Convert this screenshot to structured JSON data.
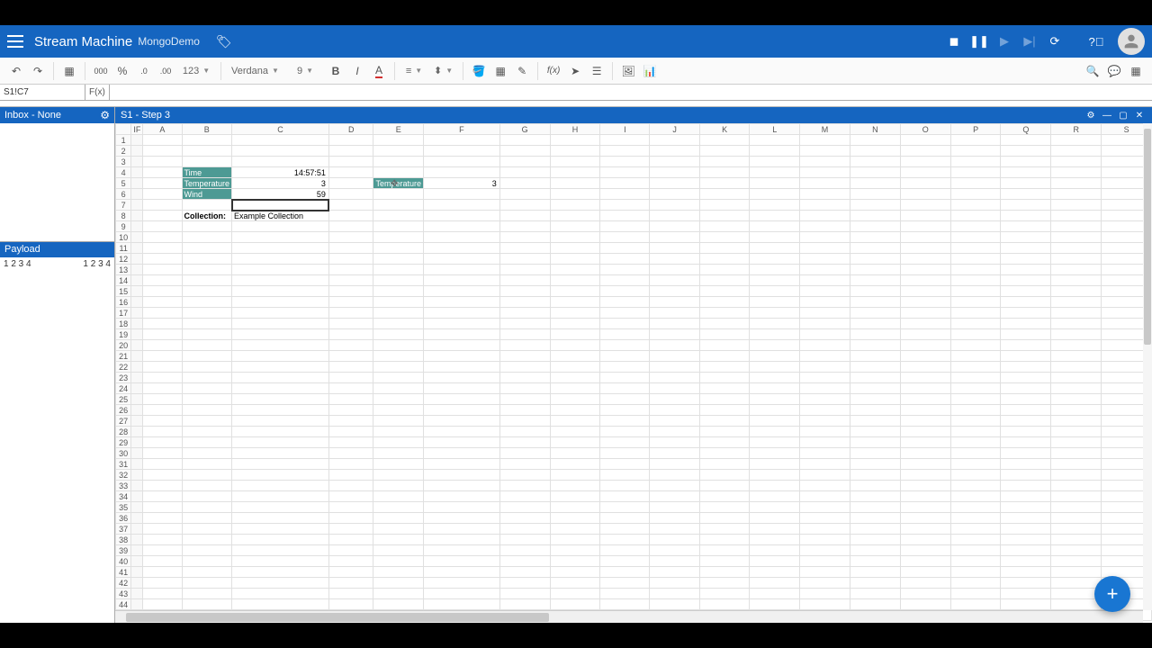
{
  "header": {
    "app_title": "Stream Machine",
    "doc_name": "MongoDemo"
  },
  "toolbar": {
    "num_format": "123",
    "font_name": "Verdana",
    "font_size": "9"
  },
  "formula": {
    "cell_ref": "S1!C7",
    "fx_label": "F(x)"
  },
  "side": {
    "inbox_title": "Inbox - None",
    "payload_title": "Payload",
    "payload_left": "1 2 3 4",
    "payload_right": "1 2 3 4"
  },
  "tab": {
    "title": "S1 - Step 3"
  },
  "columns": [
    "IF",
    "A",
    "B",
    "C",
    "D",
    "E",
    "F",
    "G",
    "H",
    "I",
    "J",
    "K",
    "L",
    "M",
    "N",
    "O",
    "P",
    "Q",
    "R",
    "S"
  ],
  "row_count": 45,
  "cells": {
    "b4": "Time",
    "c4": "14:57:51",
    "b5": "Temperature",
    "c5": "3",
    "b6": "Wind",
    "c6": "59",
    "b8": "Collection:",
    "c8": "Example Collection",
    "e5": "Temperature",
    "f5": "3"
  },
  "fab": {
    "label": "+"
  }
}
